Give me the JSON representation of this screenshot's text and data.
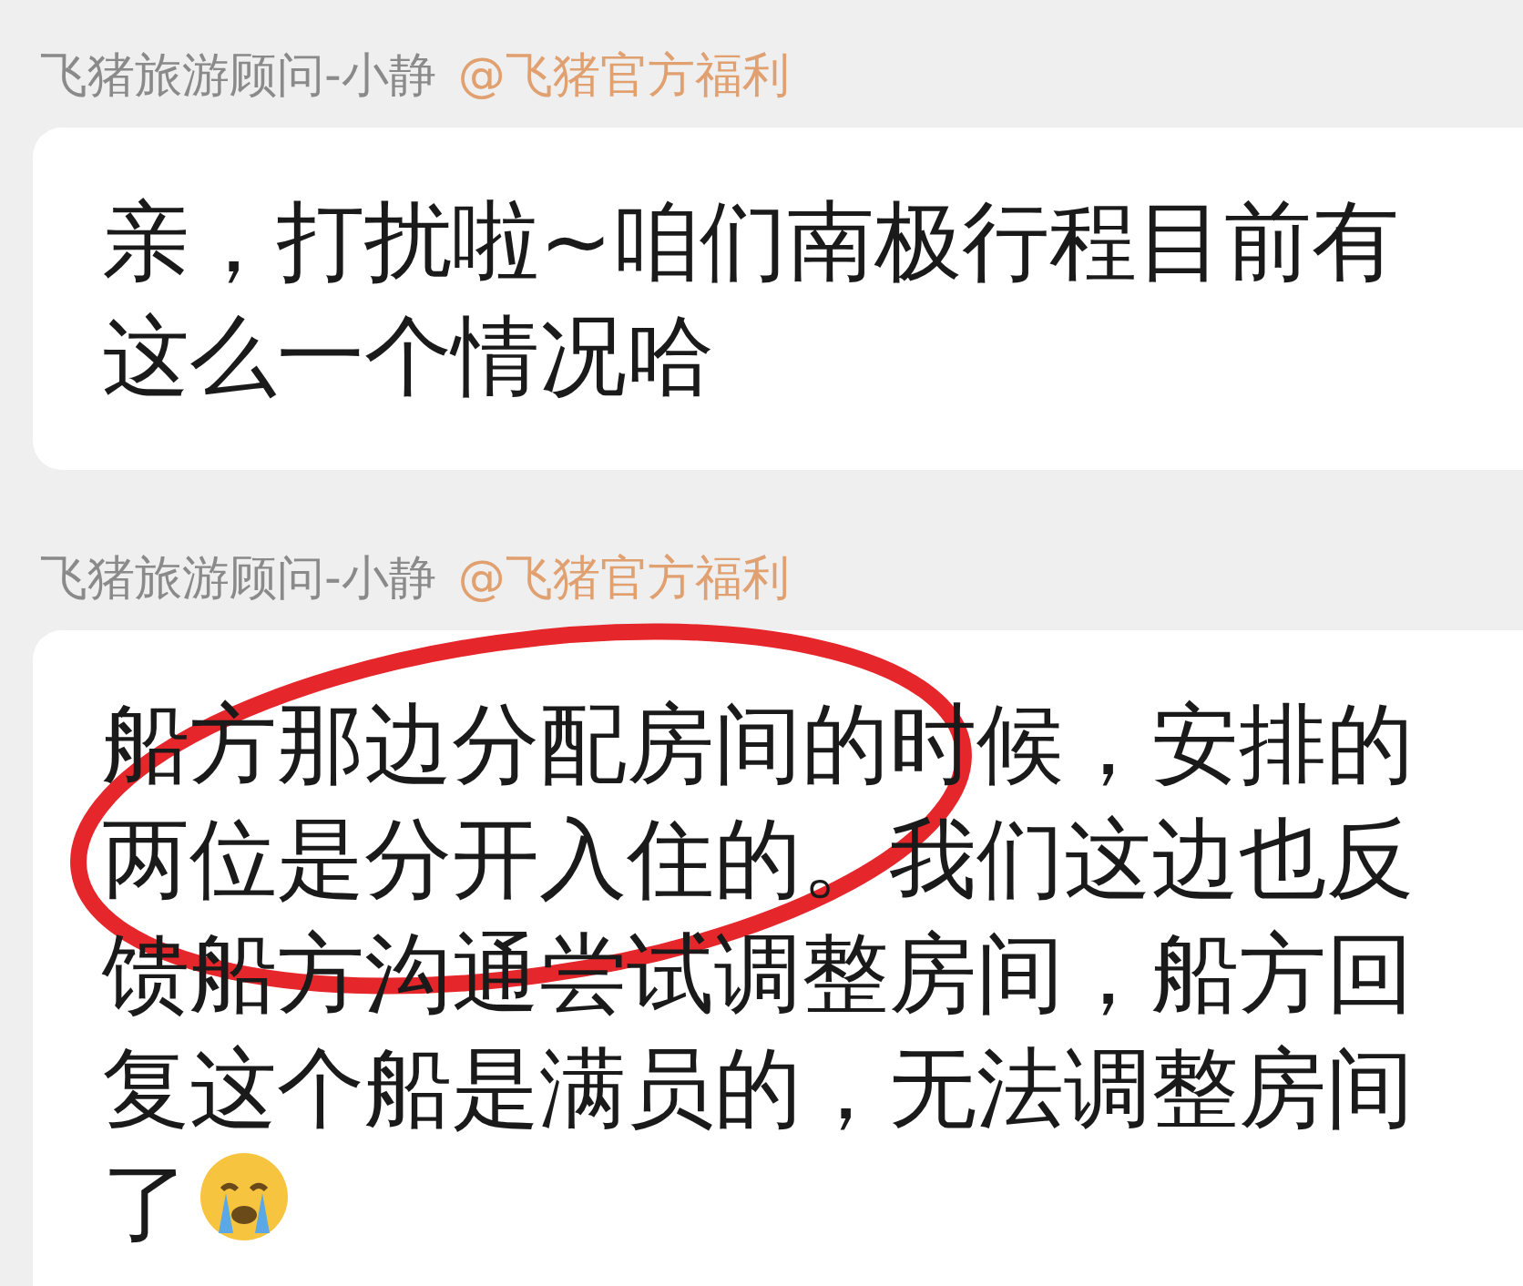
{
  "messages": [
    {
      "sender": "飞猪旅游顾问-小静",
      "mention": "@飞猪官方福利",
      "text": "亲，打扰啦~咱们南极行程目前有这么一个情况哈",
      "emoji": false,
      "annotated": false
    },
    {
      "sender": "飞猪旅游顾问-小静",
      "mention": "@飞猪官方福利",
      "text": "船方那边分配房间的时候，安排的两位是分开入住的。我们这边也反馈船方沟通尝试调整房间，船方回复这个船是满员的，无法调整房间了",
      "emoji": true,
      "annotated": true
    }
  ]
}
